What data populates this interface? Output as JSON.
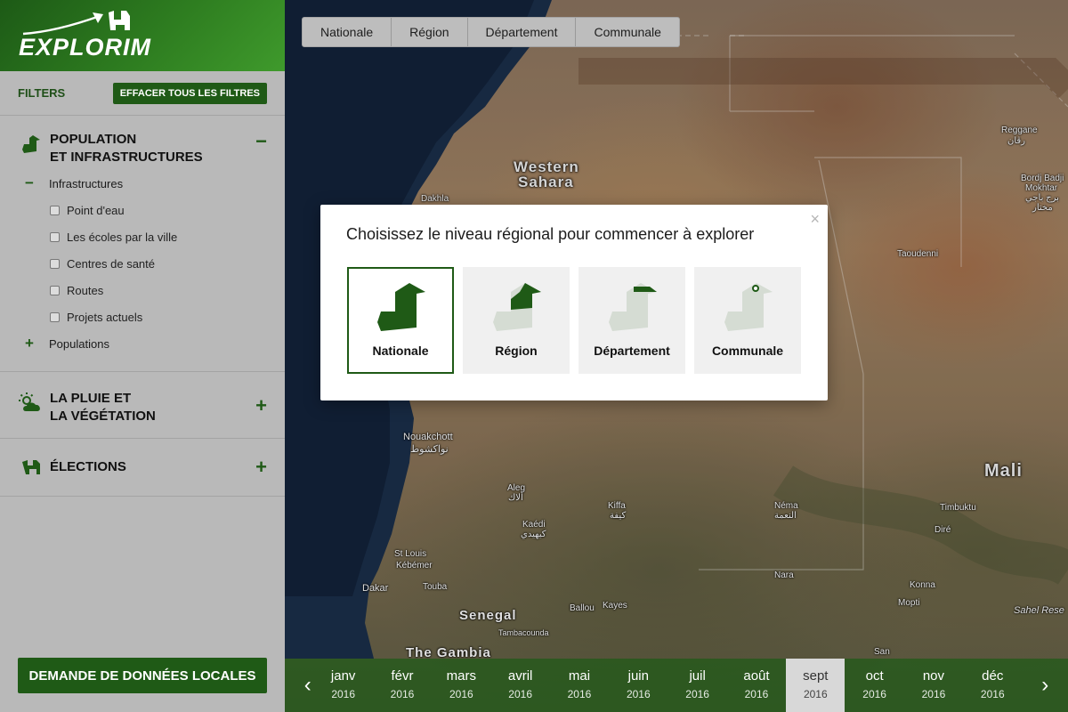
{
  "app": {
    "brand": "EXPLORIM"
  },
  "level_tabs": [
    "Nationale",
    "Région",
    "Département",
    "Communale"
  ],
  "sidebar": {
    "filters_title": "FILTERS",
    "clear_all_label": "EFFACER TOUS LES FILTRES",
    "sections": {
      "population": {
        "title_line1": "POPULATION",
        "title_line2": "ET INFRASTRUCTURES",
        "toggle": "−",
        "infrastructures": {
          "label": "Infrastructures",
          "toggle": "−",
          "items": [
            "Point d'eau",
            "Les écoles par la ville",
            "Centres de santé",
            "Routes",
            "Projets actuels"
          ]
        },
        "populations": {
          "label": "Populations",
          "toggle": "+"
        }
      },
      "rain": {
        "title_line1": "LA PLUIE ET",
        "title_line2": "LA VÉGÉTATION",
        "toggle": "+"
      },
      "elections": {
        "title": "ÉLECTIONS",
        "toggle": "+"
      }
    },
    "request_button": "DEMANDE DE DONNÉES LOCALES"
  },
  "map": {
    "labels": {
      "western_sahara_1": "Western",
      "western_sahara_2": "Sahara",
      "dakhla": "Dakhla",
      "reggane": "Reggane",
      "reggane_ar": "رڨان",
      "bordj1": "Bordj Badji",
      "bordj2": "Mokhtar",
      "bordj3": "برج باجي",
      "bordj4": "مختار",
      "taoudenni": "Taoudenni",
      "nouakchott": "Nouakchott",
      "nouakchott_ar": "نواكشوط",
      "aleg": "Aleg",
      "aleg_ar": "ألاك",
      "kiffa": "Kiffa",
      "kiffa_ar": "كيفة",
      "nema": "Néma",
      "nema_ar": "النعمة",
      "kaedi": "Kaédi",
      "kaedi_ar": "كيهيدي",
      "mali": "Mali",
      "timbuktu": "Timbuktu",
      "dire": "Diré",
      "st_louis": "St Louis",
      "kebemer": "Kébémer",
      "touba": "Touba",
      "dakar": "Dakar",
      "senegal": "Senegal",
      "ballou": "Ballou",
      "kayes": "Kayes",
      "nara": "Nara",
      "konna": "Konna",
      "mopti": "Mopti",
      "tambacounda": "Tambacounda",
      "gambia": "The Gambia",
      "sahel": "Sahel Rese",
      "san": "San"
    }
  },
  "modal": {
    "title": "Choisissez le niveau régional pour commencer à explorer",
    "close": "×",
    "options": [
      "Nationale",
      "Région",
      "Département",
      "Communale"
    ],
    "selected": "Nationale"
  },
  "timeline": {
    "prev": "‹",
    "next": "›",
    "months": [
      {
        "m": "janv",
        "y": "2016"
      },
      {
        "m": "févr",
        "y": "2016"
      },
      {
        "m": "mars",
        "y": "2016"
      },
      {
        "m": "avril",
        "y": "2016"
      },
      {
        "m": "mai",
        "y": "2016"
      },
      {
        "m": "juin",
        "y": "2016"
      },
      {
        "m": "juil",
        "y": "2016"
      },
      {
        "m": "août",
        "y": "2016"
      },
      {
        "m": "sept",
        "y": "2016"
      },
      {
        "m": "oct",
        "y": "2016"
      },
      {
        "m": "nov",
        "y": "2016"
      },
      {
        "m": "déc",
        "y": "2016"
      }
    ],
    "active": "sept"
  },
  "colors": {
    "brand_green": "#1f5a16",
    "sidebar_bg": "#b9b9b9"
  }
}
